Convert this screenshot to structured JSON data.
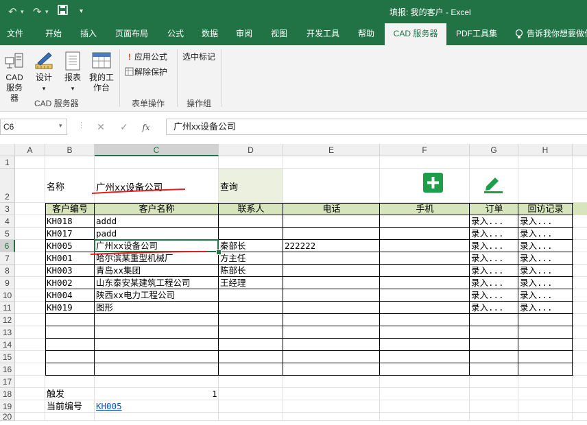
{
  "app": {
    "title": "填报: 我的客户 - Excel"
  },
  "tabs": [
    {
      "label": "文件"
    },
    {
      "label": "开始"
    },
    {
      "label": "插入"
    },
    {
      "label": "页面布局"
    },
    {
      "label": "公式"
    },
    {
      "label": "数据"
    },
    {
      "label": "审阅"
    },
    {
      "label": "视图"
    },
    {
      "label": "开发工具"
    },
    {
      "label": "帮助"
    },
    {
      "label": "CAD 服务器",
      "active": true
    },
    {
      "label": "PDF工具集"
    },
    {
      "label": "告诉我你想要做什"
    }
  ],
  "ribbon": {
    "cad_server": "CAD 服务器",
    "design": "设计",
    "report": "报表",
    "my_workbench": "我的工作台",
    "group_cad": "CAD 服务器",
    "apply_formula": "应用公式",
    "remove_protection": "解除保护",
    "group_form_ops": "表单操作",
    "select_mark": "选中标记",
    "group_ops": "操作组"
  },
  "formula_bar": {
    "name_box": "C6",
    "value": "广州xx设备公司"
  },
  "columns": [
    "A",
    "B",
    "C",
    "D",
    "E",
    "F",
    "G",
    "H"
  ],
  "rows": [
    "1",
    "2",
    "3",
    "4",
    "5",
    "6",
    "7",
    "8",
    "9",
    "10",
    "11",
    "12",
    "13",
    "14",
    "15",
    "16",
    "17",
    "18",
    "19",
    "20"
  ],
  "selected_cell": {
    "column": "C",
    "row": "6"
  },
  "form": {
    "name_label": "名称",
    "name_value": "广州xx设备公司",
    "query_label": "查询",
    "add_icon": "plus-icon",
    "edit_icon": "pencil-icon"
  },
  "table": {
    "headers": [
      "客户编号",
      "客户名称",
      "联系人",
      "电话",
      "手机",
      "订单",
      "回访记录"
    ],
    "rows": [
      [
        "KH018",
        "addd",
        "",
        "",
        "",
        "录入...",
        "录入..."
      ],
      [
        "KH017",
        "padd",
        "",
        "",
        "",
        "录入...",
        "录入..."
      ],
      [
        "KH005",
        "广州xx设备公司",
        "秦部长",
        "222222",
        "",
        "录入...",
        "录入..."
      ],
      [
        "KH001",
        "哈尔滨某重型机械厂",
        "方主任",
        "",
        "",
        "录入...",
        "录入..."
      ],
      [
        "KH003",
        "青岛xx集团",
        "陈部长",
        "",
        "",
        "录入...",
        "录入..."
      ],
      [
        "KH002",
        "山东泰安某建筑工程公司",
        "王经理",
        "",
        "",
        "录入...",
        "录入..."
      ],
      [
        "KH004",
        "陕西xx电力工程公司",
        "",
        "",
        "",
        "录入...",
        "录入..."
      ],
      [
        "KH019",
        "图形",
        "",
        "",
        "",
        "录入...",
        "录入..."
      ],
      [
        "",
        "",
        "",
        "",
        "",
        "",
        ""
      ],
      [
        "",
        "",
        "",
        "",
        "",
        "",
        ""
      ],
      [
        "",
        "",
        "",
        "",
        "",
        "",
        ""
      ],
      [
        "",
        "",
        "",
        "",
        "",
        "",
        ""
      ]
    ]
  },
  "footer": {
    "trigger_label": "触发",
    "trigger_value": "1",
    "current_id_label": "当前编号",
    "current_id_value": "KH005"
  },
  "colors": {
    "excel_green": "#217346",
    "header_fill": "#d8e4bc",
    "button_green": "#1e9e4a",
    "annotation_red": "#e0201e"
  }
}
